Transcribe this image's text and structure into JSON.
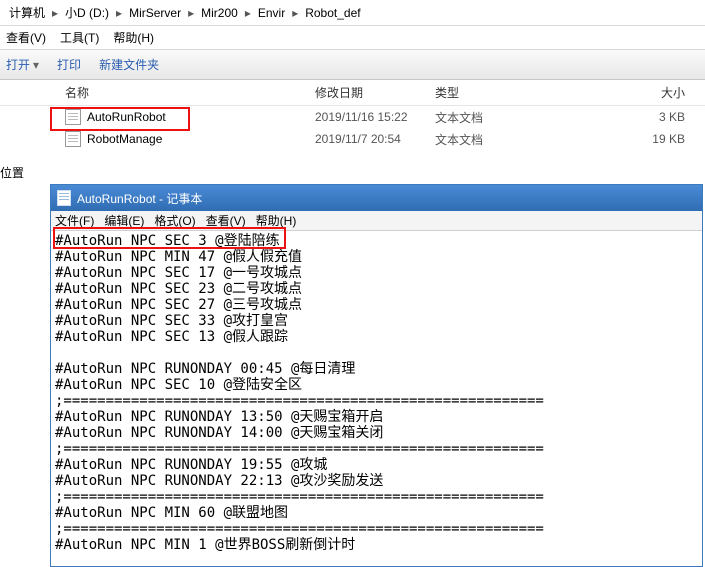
{
  "breadcrumb": {
    "items": [
      "计算机",
      "小D (D:)",
      "MirServer",
      "Mir200",
      "Envir",
      "Robot_def"
    ],
    "sep": "▸"
  },
  "menubar": {
    "view": "查看(V)",
    "tools": "工具(T)",
    "help": "帮助(H)"
  },
  "toolbar": {
    "open": "打开",
    "print": "打印",
    "newfolder": "新建文件夹",
    "arrow": "▾"
  },
  "columns": {
    "name": "名称",
    "date": "修改日期",
    "type": "类型",
    "size": "大小"
  },
  "files": [
    {
      "name": "AutoRunRobot",
      "date": "2019/11/16 15:22",
      "type": "文本文档",
      "size": "3 KB"
    },
    {
      "name": "RobotManage",
      "date": "2019/11/7 20:54",
      "type": "文本文档",
      "size": "19 KB"
    }
  ],
  "side_label": "位置",
  "notepad": {
    "title": "AutoRunRobot - 记事本",
    "menu": {
      "file": "文件(F)",
      "edit": "编辑(E)",
      "format": "格式(O)",
      "view": "查看(V)",
      "help": "帮助(H)"
    },
    "content": "#AutoRun NPC SEC 3 @登陆陪练\n#AutoRun NPC MIN 47 @假人假充值\n#AutoRun NPC SEC 17 @一号攻城点\n#AutoRun NPC SEC 23 @二号攻城点\n#AutoRun NPC SEC 27 @三号攻城点\n#AutoRun NPC SEC 33 @攻打皇宫\n#AutoRun NPC SEC 13 @假人跟踪\n\n#AutoRun NPC RUNONDAY 00:45 @每日清理\n#AutoRun NPC SEC 10 @登陆安全区\n;=========================================================\n#AutoRun NPC RUNONDAY 13:50 @天赐宝箱开启\n#AutoRun NPC RUNONDAY 14:00 @天赐宝箱关闭\n;=========================================================\n#AutoRun NPC RUNONDAY 19:55 @攻城\n#AutoRun NPC RUNONDAY 22:13 @攻沙奖励发送\n;=========================================================\n#AutoRun NPC MIN 60 @联盟地图\n;=========================================================\n#AutoRun NPC MIN 1 @世界BOSS刷新倒计时"
  }
}
